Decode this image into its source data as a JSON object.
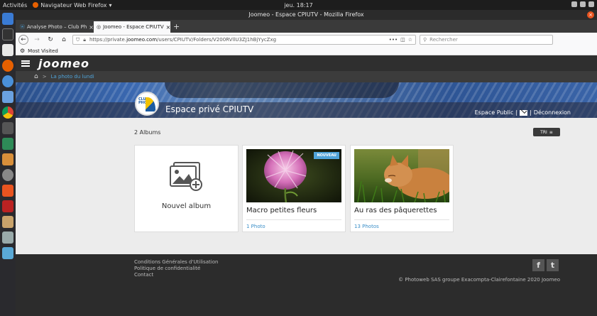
{
  "system": {
    "activities": "Activités",
    "app_menu": "Navigateur Web Firefox",
    "clock": "jeu. 18:17"
  },
  "window": {
    "title": "Joomeo - Espace CPIUTV - Mozilla Firefox"
  },
  "tabs": [
    {
      "label": "Analyse Photo – Club Ph",
      "active": false
    },
    {
      "label": "Joomeo - Espace CPIUTV",
      "active": true
    }
  ],
  "url": {
    "prefix": "https://private.",
    "domain": "joomeo.com",
    "path": "/users/CPIUTV/Folders/V200RVllU3ZJ1hBjYycZxg"
  },
  "search": {
    "placeholder": "Rechercher"
  },
  "bookmarks": {
    "most_visited": "Most Visited"
  },
  "site": {
    "logo": "joomeo",
    "breadcrumb": "La photo du lundi",
    "space_title": "Espace privé CPIUTV",
    "club_logo_text": "CLUB PHOTO",
    "public_link": "Espace Public",
    "logout_link": "Déconnexion",
    "sep": "|"
  },
  "albums": {
    "count_label": "2 Albums",
    "sort_label": "TRI",
    "new_album_label": "Nouvel album",
    "items": [
      {
        "name": "Macro petites fleurs",
        "photos": "1 Photo",
        "badge": "NOUVEAU"
      },
      {
        "name": "Au ras des pâquerettes",
        "photos": "13 Photos"
      }
    ]
  },
  "footer": {
    "links": [
      "Conditions Générales d'Utilisation",
      "Politique de confidentialité",
      "Contact"
    ],
    "copyright": "© Photoweb SAS groupe Exacompta-Clairefontaine 2020 Joomeo",
    "social": [
      "f",
      "t"
    ]
  },
  "colors": {
    "accent": "#4fa3d8",
    "ubuntu_orange": "#e95420",
    "header": "#2f2f2f"
  }
}
